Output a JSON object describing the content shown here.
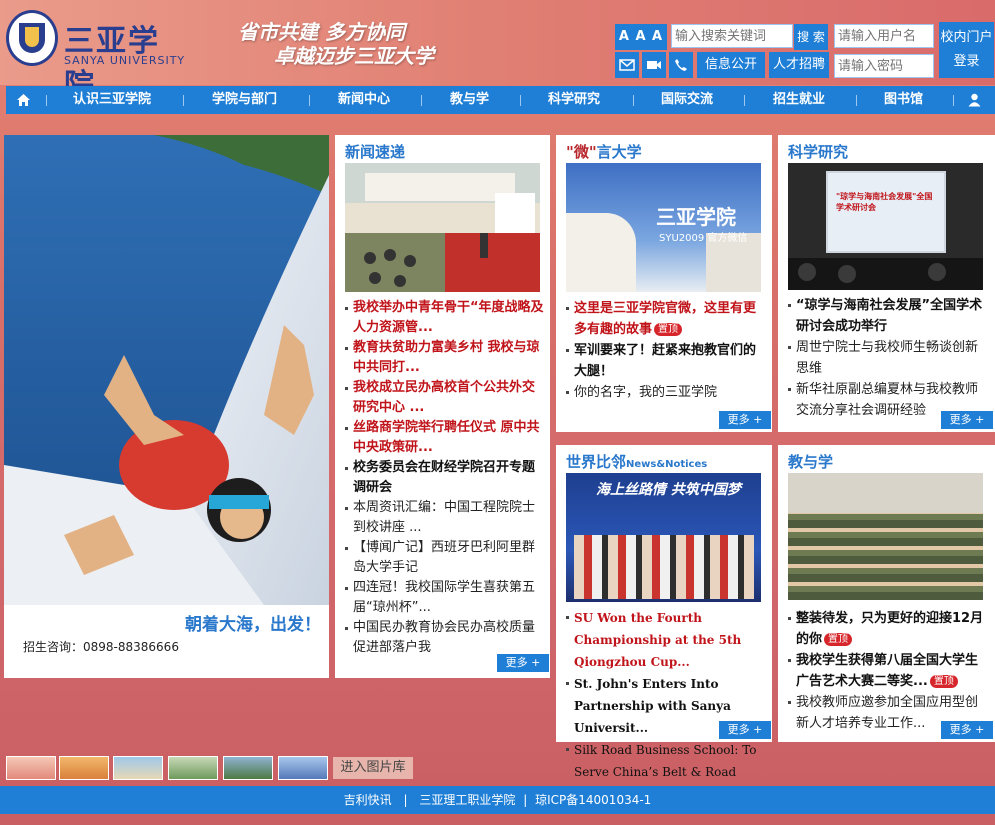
{
  "header": {
    "logo_cn": "三亚学院",
    "logo_en": "SANYA UNIVERSITY",
    "slogan_line1": "省市共建 多方协同",
    "slogan_line2": "卓越迈步三亚大学",
    "font_size_label": "A A A",
    "search_placeholder": "输入搜索关键词",
    "search_button": "搜 索",
    "username_placeholder": "请输入用户名",
    "password_placeholder": "请输入密码",
    "portal_label": "校内门户",
    "login_label": "登录",
    "info_public": "信息公开",
    "talent": "人才招聘"
  },
  "nav": {
    "items": [
      "认识三亚学院",
      "学院与部门",
      "新闻中心",
      "教与学",
      "科学研究",
      "国际交流",
      "招生就业",
      "图书馆"
    ]
  },
  "hero": {
    "caption": "朝着大海，出发！",
    "admission": "招生咨询：0898-88386666"
  },
  "news": {
    "title": "新闻速递",
    "items": [
      {
        "text": "我校举办中青年骨干“年度战略及人力资源管...",
        "style": "red"
      },
      {
        "text": "教育扶贫助力富美乡村 我校与琼中共同打...",
        "style": "red"
      },
      {
        "text": "我校成立民办高校首个公共外交研究中心 ...",
        "style": "red"
      },
      {
        "text": "丝路商学院举行聘任仪式 原中共中央政策研...",
        "style": "red"
      },
      {
        "text": "校务委员会在财经学院召开专题调研会",
        "style": "dark"
      },
      {
        "text": "本周资讯汇编：中国工程院院士到校讲座 ...",
        "style": "normal"
      },
      {
        "text": "【博闻广记】西班牙巴利阿里群岛大学手记",
        "style": "normal"
      },
      {
        "text": "四连冠！我校国际学生喜获第五届“琼州杯”...",
        "style": "normal"
      },
      {
        "text": "中国民办教育协会民办高校质量促进部落户我",
        "style": "normal"
      }
    ],
    "more": "更多 +"
  },
  "weiyan": {
    "title_quote": "\"微\"",
    "title_rest": "言大学",
    "image_text": "三亚学院",
    "image_sub": "SYU2009 官方微信",
    "items": [
      {
        "text": "这里是三亚学院官微，这里有更多有趣的故事",
        "style": "red",
        "badge": "置顶"
      },
      {
        "text": "军训要来了！赶紧来抱教官们的大腿！",
        "style": "dark"
      },
      {
        "text": "你的名字，我的三亚学院",
        "style": "normal"
      }
    ],
    "more": "更多 +"
  },
  "research": {
    "title": "科学研究",
    "image_text": "\"琼学与海南社会发展\"全国学术研讨会",
    "items": [
      {
        "text": "“琼学与海南社会发展”全国学术研讨会成功举行",
        "style": "dark"
      },
      {
        "text": "周世宁院士与我校师生畅谈创新思维",
        "style": "normal"
      },
      {
        "text": "新华社原副总编夏林与我校教师交流分享社会调研经验",
        "style": "normal"
      }
    ],
    "more": "更多 +"
  },
  "world": {
    "title": "世界比邻",
    "subtitle": "News&Notices",
    "image_text": "海上丝路情 共筑中国梦",
    "items": [
      {
        "text": "SU Won the Fourth Championship at the 5th Qiongzhou Cup...",
        "style": "red"
      },
      {
        "text": "St. John's Enters Into Partnership with Sanya Universit...",
        "style": "dark"
      },
      {
        "text": "Silk Road Business School: To Serve China’s Belt & Road",
        "style": "dark"
      }
    ],
    "more": "更多 +"
  },
  "teach": {
    "title": "教与学",
    "items": [
      {
        "text": "整装待发，只为更好的迎接12月的你",
        "style": "dark",
        "badge": "置顶"
      },
      {
        "text": "我校学生获得第八届全国大学生广告艺术大赛二等奖...",
        "style": "dark",
        "badge": "置顶"
      },
      {
        "text": "我校教师应邀参加全国应用型创新人才培养专业工作...",
        "style": "normal"
      }
    ],
    "more": "更多 +"
  },
  "gallery": {
    "label": "进入图片库"
  },
  "footer": {
    "link1": "吉利快讯",
    "link2": "三亚理工职业学院",
    "icp": "琼ICP备14001034-1"
  },
  "colors": {
    "primary": "#1f7fd6",
    "accent_red": "#c0141a",
    "title_blue": "#2a78cc",
    "logo_blue": "#2a3e8f"
  }
}
